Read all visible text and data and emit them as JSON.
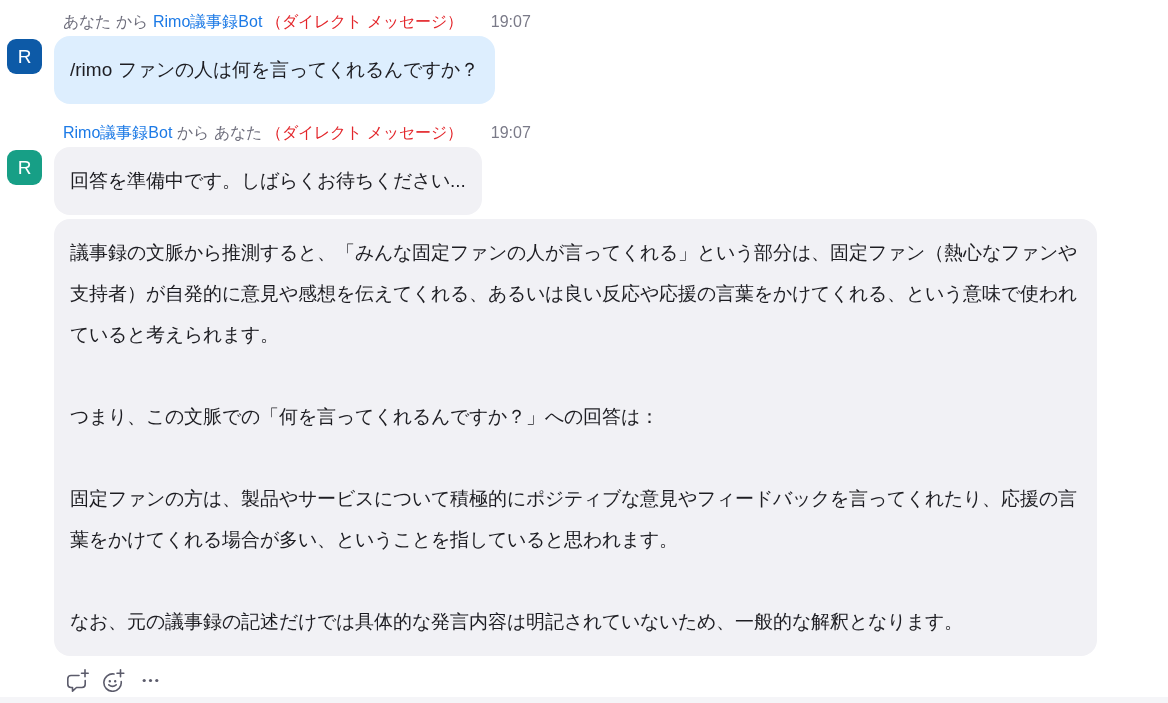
{
  "messages": [
    {
      "from": {
        "name": "あなた",
        "kind": "self"
      },
      "connector": "から",
      "to": {
        "name": "Rimo議事録Bot",
        "kind": "bot"
      },
      "channel": "（ダイレクト メッセージ）",
      "time": "19:07",
      "avatar": {
        "initial": "R",
        "color": "#0d5aa7"
      },
      "bubbles": [
        {
          "kind": "sent",
          "paragraphs": [
            "/rimo ファンの人は何を言ってくれるんですか？"
          ]
        }
      ]
    },
    {
      "from": {
        "name": "Rimo議事録Bot",
        "kind": "bot"
      },
      "connector": "から",
      "to": {
        "name": "あなた",
        "kind": "self"
      },
      "channel": "（ダイレクト メッセージ）",
      "time": "19:07",
      "avatar": {
        "initial": "R",
        "color": "#179f86"
      },
      "bubbles": [
        {
          "kind": "received",
          "paragraphs": [
            "回答を準備中です。しばらくお待ちください..."
          ]
        },
        {
          "kind": "received",
          "paragraphs": [
            "議事録の文脈から推測すると、「みんな固定ファンの人が言ってくれる」という部分は、固定ファン（熱心なファンや支持者）が自発的に意見や感想を伝えてくれる、あるいは良い反応や応援の言葉をかけてくれる、という意味で使われていると考えられます。",
            "つまり、この文脈での「何を言ってくれるんですか？」への回答は：",
            "固定ファンの方は、製品やサービスについて積極的にポジティブな意見やフィードバックを言ってくれたり、応援の言葉をかけてくれる場合が多い、ということを指していると思われます。",
            "なお、元の議事録の記述だけでは具体的な発言内容は明記されていないため、一般的な解釈となります。"
          ]
        }
      ],
      "actions": [
        {
          "kind": "reply"
        },
        {
          "kind": "reaction"
        },
        {
          "kind": "more"
        }
      ]
    }
  ]
}
